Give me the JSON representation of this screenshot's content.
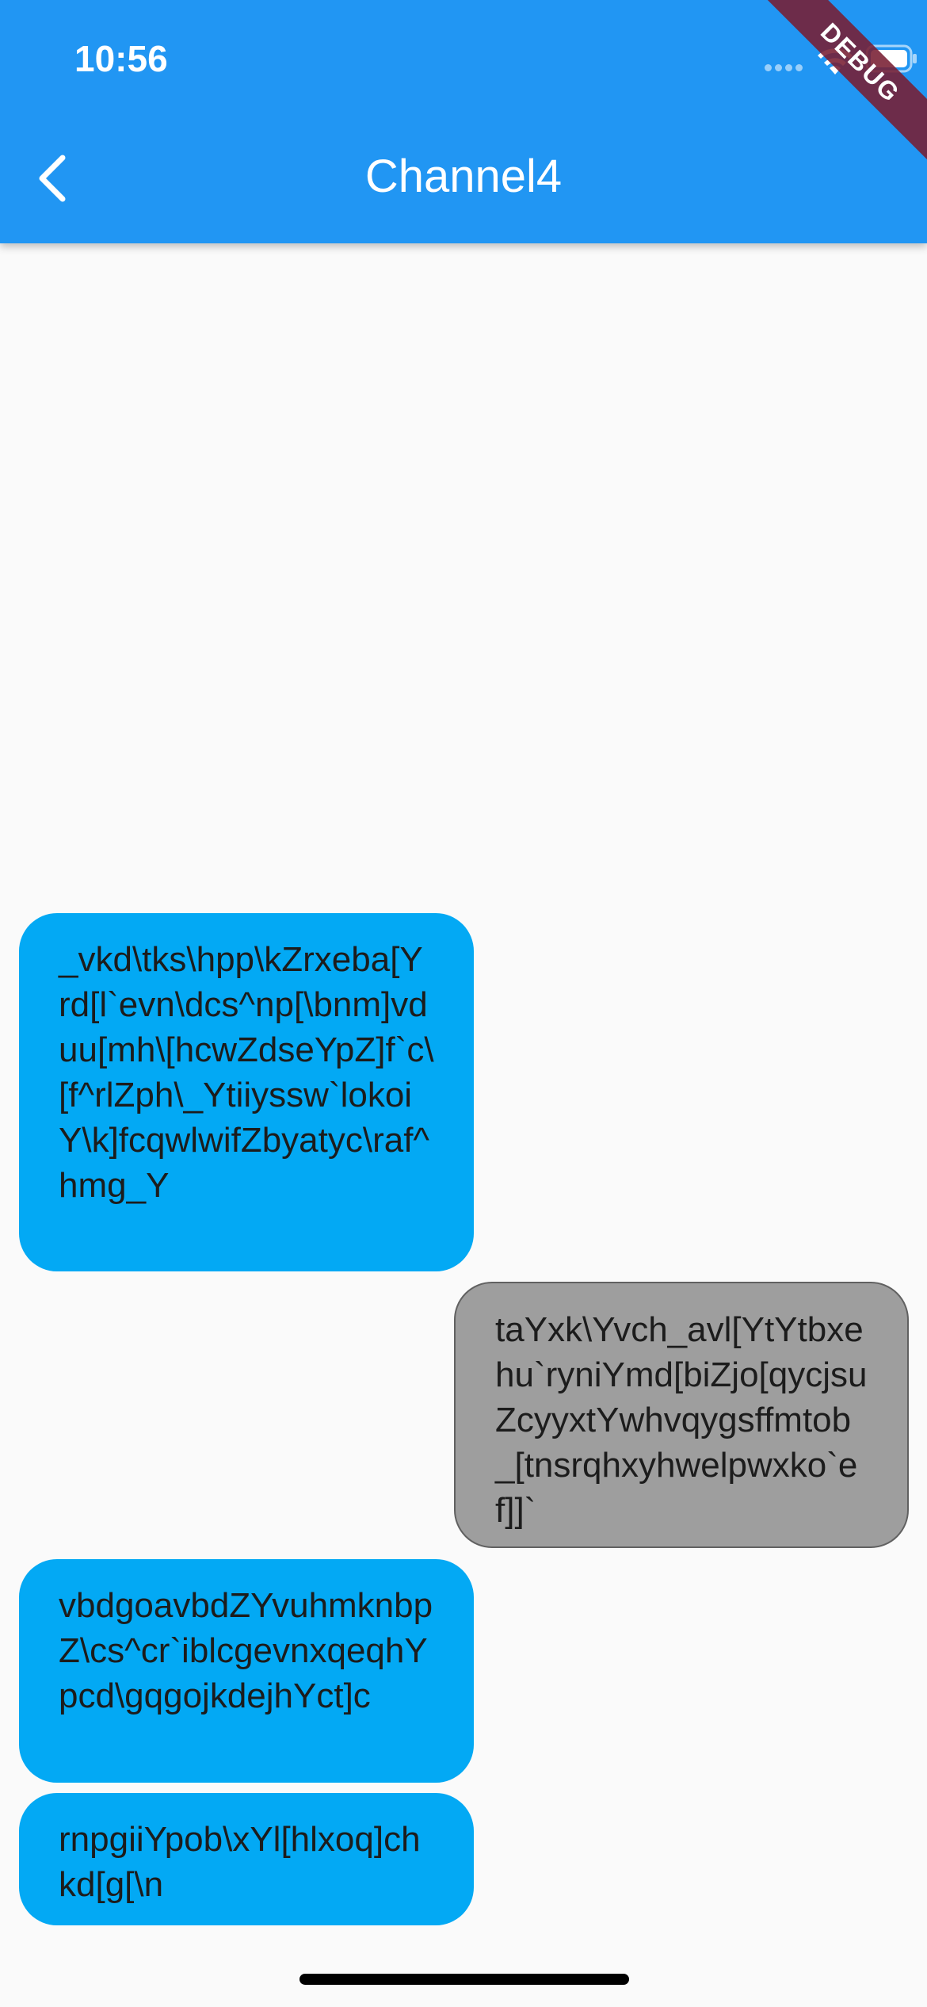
{
  "status_bar": {
    "time": "10:56",
    "icons": [
      "cellular-signal-icon",
      "wifi-icon",
      "battery-icon"
    ]
  },
  "debug_banner": {
    "label": "DEBUG"
  },
  "app_bar": {
    "title": "Channel4",
    "back_icon": "chevron-left-icon",
    "color": "#2196f3"
  },
  "messages": [
    {
      "side": "left",
      "text": "_vkd\\tks\\hpp\\kZrxeba[Yrd[l`evn\\dcs^np[\\bnm]vduu[mh\\[hcwZdseYpZ]f`c\\[f^rlZph\\_Ytiiyssw`lokoiY\\k]fcqwlwifZbyatyc\\raf^hmg_Y",
      "color": "#03a9f4"
    },
    {
      "side": "right",
      "text": "taYxk\\Yvch_avl[YtYtbxehu`ryniYmd[biZjo[qycjsuZcyyxtYwhvqygsffmtob_[tnsrqhxyhwelpwxko`ef]]`",
      "color": "#9e9e9e"
    },
    {
      "side": "left",
      "text": "vbdgoavbdZYvuhmknbpZ\\cs^cr`iblcgevnxqeqhYpcd\\gqgojkdejhYct]c",
      "color": "#03a9f4"
    },
    {
      "side": "left",
      "text": "rnpgiiYpob\\xYl[hlxoq]chkd[g[\\n",
      "color": "#03a9f4"
    }
  ]
}
